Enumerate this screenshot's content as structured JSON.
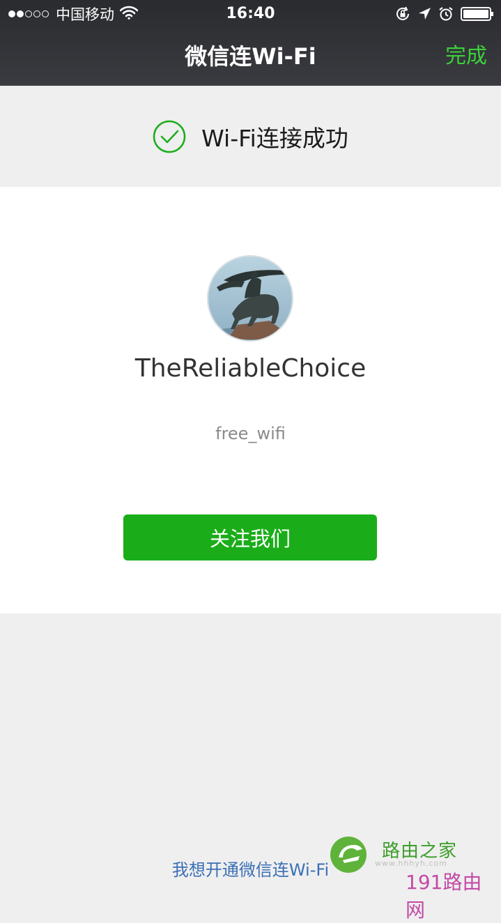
{
  "status_bar": {
    "carrier": "中国移动",
    "time": "16:40",
    "signal_bars_filled": 2,
    "signal_bars_total": 5,
    "battery_level": 1.0,
    "icons": [
      "wifi-icon",
      "orientation-lock-icon",
      "location-arrow-icon",
      "alarm-icon",
      "battery-icon"
    ]
  },
  "nav": {
    "title": "微信连Wi-Fi",
    "done_label": "完成"
  },
  "success": {
    "icon": "check-circle-icon",
    "message": "Wi-Fi连接成功"
  },
  "account": {
    "name": "TheReliableChoice",
    "ssid": "free_wifi",
    "follow_button": "关注我们"
  },
  "footer": {
    "link": "我想开通微信连Wi-Fi"
  },
  "watermark": {
    "brand": "路由之家",
    "domain": "www.hhhyh.com",
    "site": "191路由网"
  },
  "colors": {
    "accent_green": "#1aad19",
    "done_green": "#3bd13b",
    "link_blue": "#3b6fb6",
    "nav_bg": "#2e2f33",
    "page_bg": "#efefef"
  }
}
